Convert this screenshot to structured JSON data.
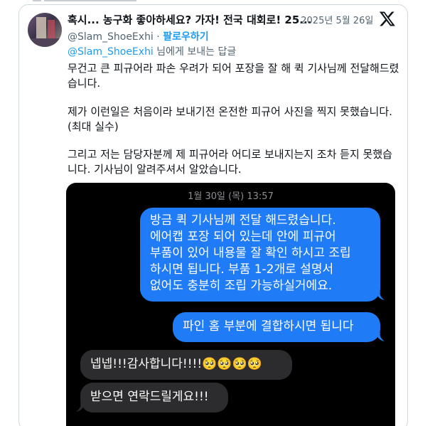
{
  "tweet": {
    "title": "혹시... 농구화 좋아하세요? 가자! 전국 대회로! 25...",
    "date": "· 2025년 5월 26일",
    "handle": "@Slam_ShoeExhi",
    "separator": " · ",
    "follow_label": "팔로우하기",
    "reply_to_handle": "@Slam_ShoeExhi",
    "reply_suffix": " 님에게 보내는 답글",
    "paragraph1_line1": "무건고 큰 피규어라 파손 우려가 되어 포장을 잘 해 퀵 기사님께 전달해드렸",
    "paragraph1_line2": "습니다.",
    "paragraph2_line1": "제가 이런일은 처음이라 보내기전 온전한 피규어 사진을 찍지 못했습니다.",
    "paragraph2_line2": "(최대 실수)",
    "paragraph3_line1": "그리고 저는 담당자분께 제 피규어라 어디로 보내지는지 조차 듣지 못했습",
    "paragraph3_line2": "니다. 기사님이 알려주셔서 알았습니다."
  },
  "chat": {
    "timestamp": "1월 30일 (목) 13:57",
    "sent1_line1": "방금 퀵 기사님께 전달 해드렸습니다.",
    "sent1_line2": "에어캡 포장 되어 있는데 안에 피규어",
    "sent1_line3": "부품이 있어 내용물 잘 확인 하시고 조립",
    "sent1_line4": "하시면 됩니다. 부품 1-2개로 설명서",
    "sent1_line5": "없어도 충분히 조립 가능하실거에요.",
    "sent2": "파인 홈 부분에 결합하시면 됩니다",
    "recv1": "넵넵!!!감사합니다!!!!🥺🥺🥺🥺",
    "recv2": "받으면 연락드릴게요!!!"
  },
  "colors": {
    "accent": "#1d9bf0",
    "sent_bubble": "#1f7cf6",
    "received_bubble": "#2c2c2e",
    "secondary_text": "#536471"
  },
  "icons": {
    "platform_logo": "x-logo-icon"
  }
}
